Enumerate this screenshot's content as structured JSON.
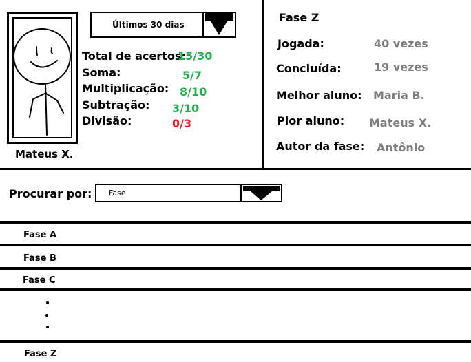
{
  "student": {
    "name": "Mateus X."
  },
  "period_filter": {
    "selected": "Últimos 30 dias"
  },
  "stats": {
    "total": {
      "label": "Total de acertos:",
      "value": "15/30",
      "color": "#22b14c"
    },
    "items": [
      {
        "label": "Soma:",
        "value": "5/7",
        "color": "#22b14c"
      },
      {
        "label": "Multiplicação:",
        "value": "8/10",
        "color": "#22b14c"
      },
      {
        "label": "Subtração:",
        "value": "3/10",
        "color": "#22b14c"
      },
      {
        "label": "Divisão:",
        "value": "0/3",
        "color": "#ed1c24"
      }
    ]
  },
  "phase": {
    "title": "Fase Z",
    "details": [
      {
        "label": "Jogada:",
        "value": "40 vezes"
      },
      {
        "label": "Concluída:",
        "value": "19 vezes"
      },
      {
        "label": "Melhor aluno:",
        "value": "Maria B."
      },
      {
        "label": "Pior aluno:",
        "value": "Mateus X."
      },
      {
        "label": "Autor da fase:",
        "value": "Antônio"
      }
    ]
  },
  "search": {
    "label": "Procurar por:",
    "selected": "Fase"
  },
  "phase_list": {
    "items": [
      "Fase A",
      "Fase B",
      "Fase C"
    ],
    "last": "Fase Z"
  },
  "colors": {
    "success": "#22b14c",
    "error": "#ed1c24",
    "muted": "#7f7f7f"
  },
  "icons": {
    "dropdown": "arrow-down-icon",
    "avatar": "stick-figure-icon"
  }
}
